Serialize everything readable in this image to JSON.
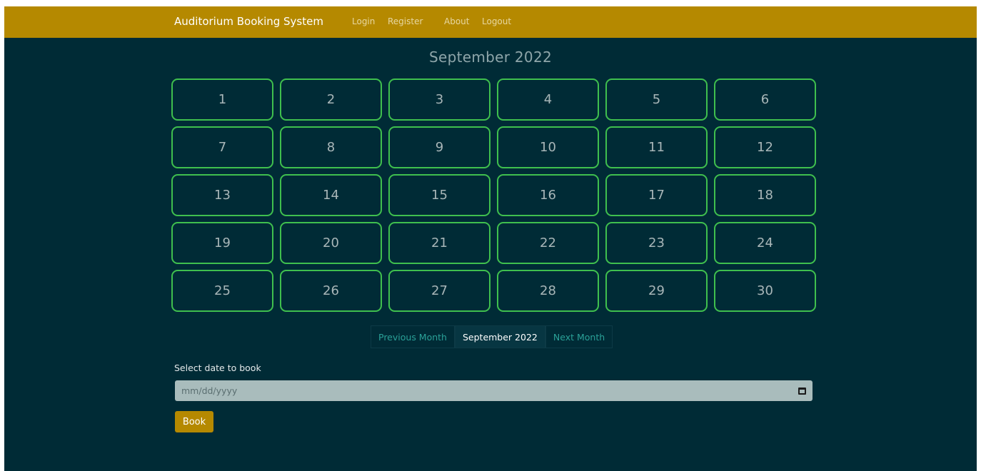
{
  "navbar": {
    "brand": "Auditorium Booking System",
    "links": [
      "Login",
      "Register",
      "About",
      "Logout"
    ]
  },
  "calendar": {
    "title": "September 2022",
    "days": [
      "1",
      "2",
      "3",
      "4",
      "5",
      "6",
      "7",
      "8",
      "9",
      "10",
      "11",
      "12",
      "13",
      "14",
      "15",
      "16",
      "17",
      "18",
      "19",
      "20",
      "21",
      "22",
      "23",
      "24",
      "25",
      "26",
      "27",
      "28",
      "29",
      "30"
    ]
  },
  "pager": {
    "prev": "Previous Month",
    "current": "September 2022",
    "next": "Next Month"
  },
  "form": {
    "label": "Select date to book",
    "date_placeholder": "mm/dd/yyyy",
    "calendar_icon": "calendar-icon",
    "book_label": "Book"
  },
  "colors": {
    "navbar": "#b58900",
    "background": "#002b36",
    "day_border": "#3fbf4e",
    "link": "#2aa198",
    "input": "#a9bcbc"
  }
}
